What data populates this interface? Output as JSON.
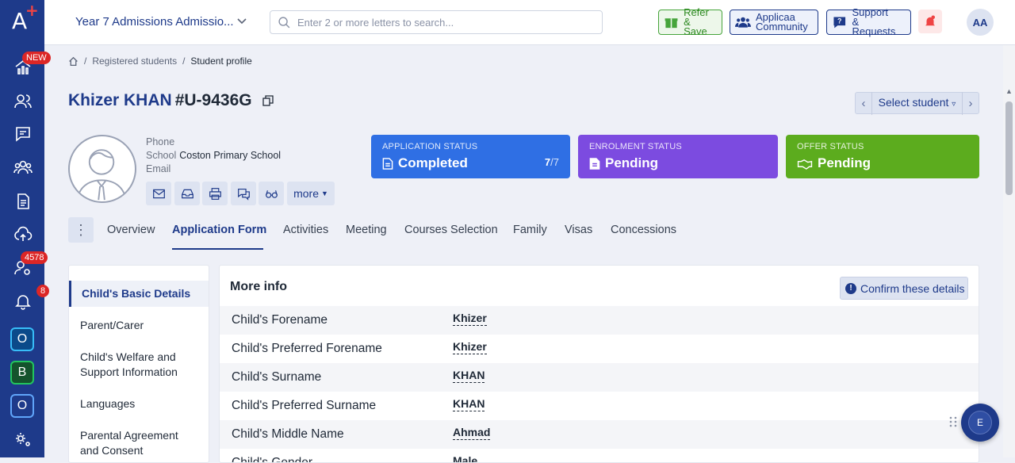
{
  "sidebar": {
    "badges": {
      "dashboard": "NEW",
      "applicants": "4578",
      "notifications": "8"
    },
    "apps": [
      "O",
      "B",
      "O"
    ]
  },
  "topbar": {
    "dataset": "Year 7 Admissions Admissio...",
    "search_placeholder": "Enter 2 or more letters to search...",
    "refer": [
      "Refer",
      "& Save"
    ],
    "community": [
      "Applicaa",
      "Community"
    ],
    "support": [
      "Support",
      "& Requests"
    ],
    "avatar": "AA"
  },
  "breadcrumb": [
    "Registered students",
    "Student profile"
  ],
  "student": {
    "name": "Khizer KHAN",
    "id": "#U-9436G",
    "phone_label": "Phone",
    "school_label": "School",
    "school": "Coston Primary School",
    "email_label": "Email",
    "more_label": "more",
    "select_student": "Select student"
  },
  "statuses": {
    "application": {
      "label": "APPLICATION STATUS",
      "value": "Completed",
      "count": "7",
      "total": "/7"
    },
    "enrolment": {
      "label": "ENROLMENT STATUS",
      "value": "Pending"
    },
    "offer": {
      "label": "OFFER STATUS",
      "value": "Pending"
    }
  },
  "tabs": [
    "Overview",
    "Application Form",
    "Activities",
    "Meeting",
    "Courses Selection",
    "Family",
    "Visas",
    "Concessions"
  ],
  "sections": [
    "Child's Basic Details",
    "Parent/Carer",
    "Child's Welfare and Support Information",
    "Languages",
    "Parental Agreement and Consent"
  ],
  "form": {
    "title": "More info",
    "confirm": "Confirm these details",
    "rows": [
      {
        "label": "Child's Forename",
        "value": "Khizer"
      },
      {
        "label": "Child's Preferred Forename",
        "value": "Khizer"
      },
      {
        "label": "Child's Surname",
        "value": "KHAN"
      },
      {
        "label": "Child's Preferred Surname",
        "value": "KHAN"
      },
      {
        "label": "Child's Middle Name",
        "value": "Ahmad"
      },
      {
        "label": "Child's Gender",
        "value": "Male"
      }
    ]
  },
  "fab": "E",
  "colors": {
    "brand": "#1e3a8a",
    "application": "#2f6fe4",
    "enrolment": "#7c4be0",
    "offer": "#5cac1e"
  }
}
